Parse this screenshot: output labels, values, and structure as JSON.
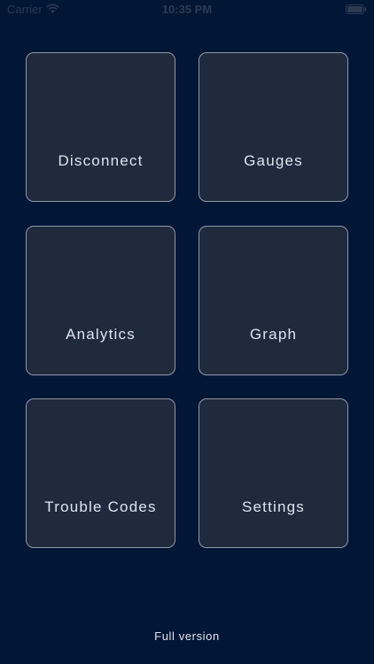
{
  "status_bar": {
    "carrier": "Carrier",
    "time": "10:35 PM",
    "icons": [
      "wifi-icon",
      "battery-icon"
    ]
  },
  "menu": {
    "tiles": [
      {
        "label": "Disconnect"
      },
      {
        "label": "Gauges"
      },
      {
        "label": "Analytics"
      },
      {
        "label": "Graph"
      },
      {
        "label": "Trouble Codes"
      },
      {
        "label": "Settings"
      }
    ]
  },
  "footer": {
    "label": "Full version"
  },
  "colors": {
    "background": "#021636",
    "tile": "#1f2a3d",
    "tile_border": "#8f99aa",
    "text": "#dfe4ee"
  }
}
